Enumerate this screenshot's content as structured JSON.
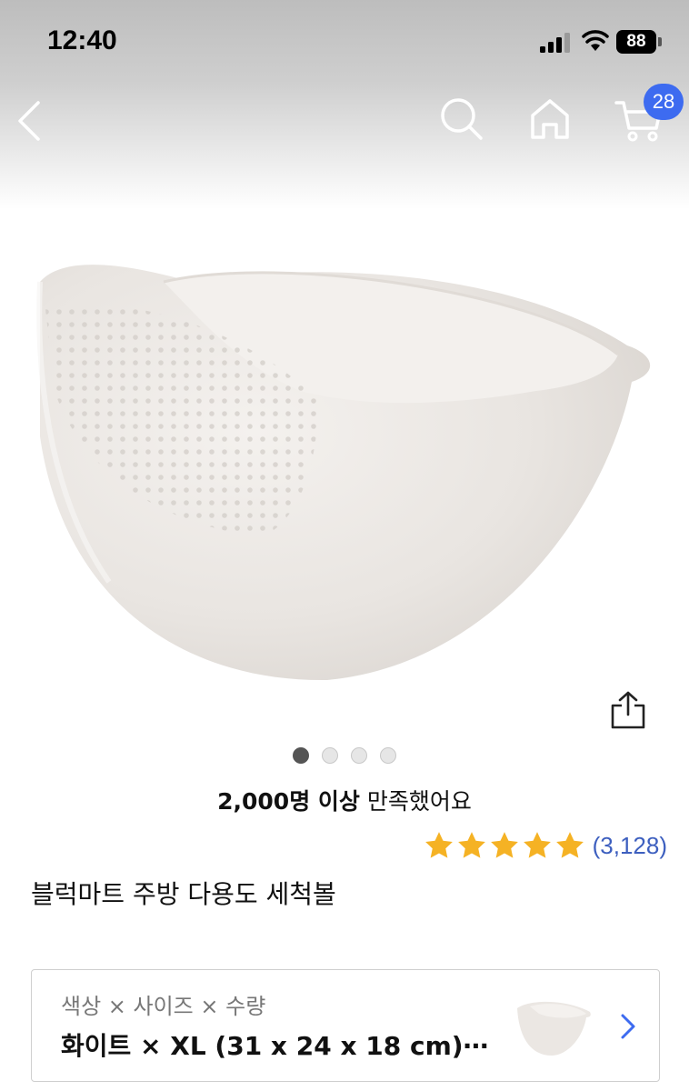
{
  "status_bar": {
    "time": "12:40",
    "battery": "88"
  },
  "nav": {
    "back_icon": "chevron-left-icon",
    "search_icon": "search-icon",
    "home_icon": "home-icon",
    "cart_icon": "cart-icon",
    "cart_count": "28"
  },
  "carousel": {
    "page_count": 4,
    "active_index": 0
  },
  "satisfaction": {
    "strong": "2,000명 이상",
    "rest": " 만족했어요"
  },
  "rating": {
    "stars": 5,
    "count": "(3,128)"
  },
  "product": {
    "title": "블럭마트 주방 다용도 세척볼"
  },
  "option": {
    "label": "색상 × 사이즈 × 수량",
    "value": "화이트 × XL (31 x 24 x 18 cm)⋯"
  },
  "colors": {
    "accent": "#3d6bf0",
    "star": "#f5b224",
    "link": "#3d5fbf"
  }
}
